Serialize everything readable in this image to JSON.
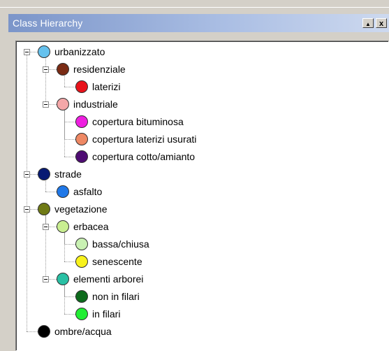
{
  "panel": {
    "title": "Class Hierarchy",
    "restore_glyph": "▲",
    "close_glyph": "x"
  },
  "tree": [
    {
      "label": "urbanizzato",
      "color": "#66c2ee",
      "level": 0,
      "expander": true
    },
    {
      "label": "residenziale",
      "color": "#7a2b14",
      "level": 1,
      "expander": true
    },
    {
      "label": "laterizi",
      "color": "#e8121a",
      "level": 2,
      "expander": false
    },
    {
      "label": "industriale",
      "color": "#f4a7a8",
      "level": 1,
      "expander": true
    },
    {
      "label": "copertura bituminosa",
      "color": "#ee1fe0",
      "level": 2,
      "expander": false
    },
    {
      "label": "copertura laterizi usurati",
      "color": "#ee8864",
      "level": 2,
      "expander": false
    },
    {
      "label": "copertura cotto/amianto",
      "color": "#4e0c72",
      "level": 2,
      "expander": false
    },
    {
      "label": "strade",
      "color": "#071a73",
      "level": 0,
      "expander": true
    },
    {
      "label": "asfalto",
      "color": "#1f78e8",
      "level": 1,
      "expander": false
    },
    {
      "label": "vegetazione",
      "color": "#6f7a15",
      "level": 0,
      "expander": true
    },
    {
      "label": "erbacea",
      "color": "#c9ee91",
      "level": 1,
      "expander": true
    },
    {
      "label": "bassa/chiusa",
      "color": "#c9f1b3",
      "level": 2,
      "expander": false
    },
    {
      "label": "senescente",
      "color": "#f8f21c",
      "level": 2,
      "expander": false
    },
    {
      "label": "elementi arborei",
      "color": "#29c0a4",
      "level": 1,
      "expander": true
    },
    {
      "label": "non in filari",
      "color": "#0d6a1c",
      "level": 2,
      "expander": false
    },
    {
      "label": "in filari",
      "color": "#22ee34",
      "level": 2,
      "expander": false
    },
    {
      "label": "ombre/acqua",
      "color": "#000000",
      "level": 0,
      "expander": false
    }
  ]
}
